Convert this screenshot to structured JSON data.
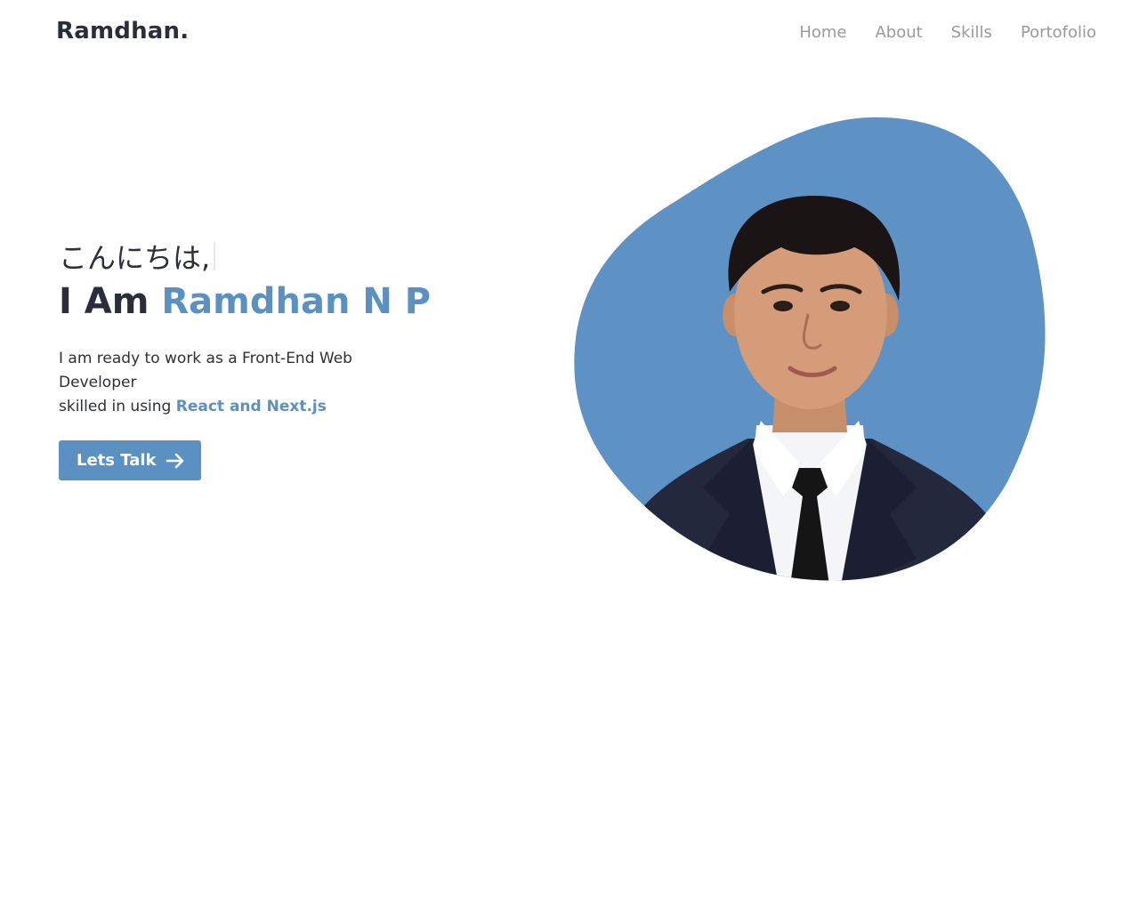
{
  "brand": {
    "logo": "Ramdhan."
  },
  "nav": {
    "items": [
      {
        "label": "Home"
      },
      {
        "label": "About"
      },
      {
        "label": "Skills"
      },
      {
        "label": "Portofolio"
      }
    ]
  },
  "hero": {
    "greeting": "こんにちは,",
    "headline_prefix": "I Am ",
    "headline_name": "Ramdhan N P",
    "description_line1": "I am ready to work as a Front-End Web Developer",
    "description_line2_prefix": "skilled in using ",
    "description_highlight": "React and Next.js",
    "cta_label": "Lets Talk",
    "cta_icon": "arrow-right-icon"
  },
  "portrait": {
    "image": "profile-photo",
    "blob_color": "#5e92c5"
  },
  "colors": {
    "accent": "#5b90c3",
    "text": "#2b2e3a",
    "nav_text": "#9a9a9a",
    "background": "#ffffff"
  }
}
